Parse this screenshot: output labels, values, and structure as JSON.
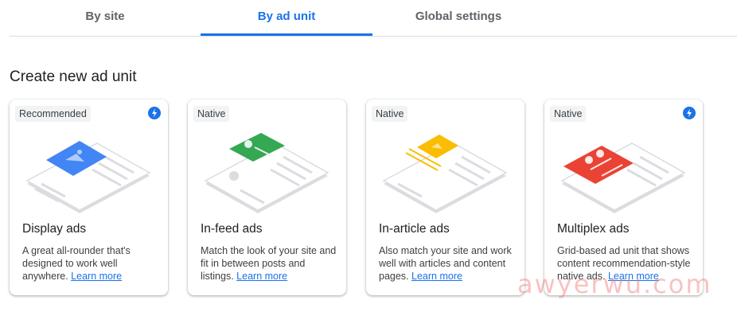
{
  "tabs": [
    {
      "label": "By site"
    },
    {
      "label": "By ad unit"
    },
    {
      "label": "Global settings"
    }
  ],
  "heading": "Create new ad unit",
  "cards": [
    {
      "badge": "Recommended",
      "title": "Display ads",
      "desc": "A great all-rounder that's designed to work well anywhere.",
      "link": "Learn more",
      "icon": "lightning-icon",
      "accent": "#4285f4"
    },
    {
      "badge": "Native",
      "title": "In-feed ads",
      "desc": "Match the look of your site and fit in between posts and listings.",
      "link": "Learn more",
      "accent": "#34a853"
    },
    {
      "badge": "Native",
      "title": "In-article ads",
      "desc": "Also match your site and work well with articles and content pages.",
      "link": "Learn more",
      "accent": "#fbbc04"
    },
    {
      "badge": "Native",
      "title": "Multiplex ads",
      "desc": "Grid-based ad unit that shows content recommendation-style native ads.",
      "link": "Learn more",
      "icon": "lightning-icon",
      "accent": "#ea4335"
    }
  ],
  "watermark": "awyerwu.com"
}
